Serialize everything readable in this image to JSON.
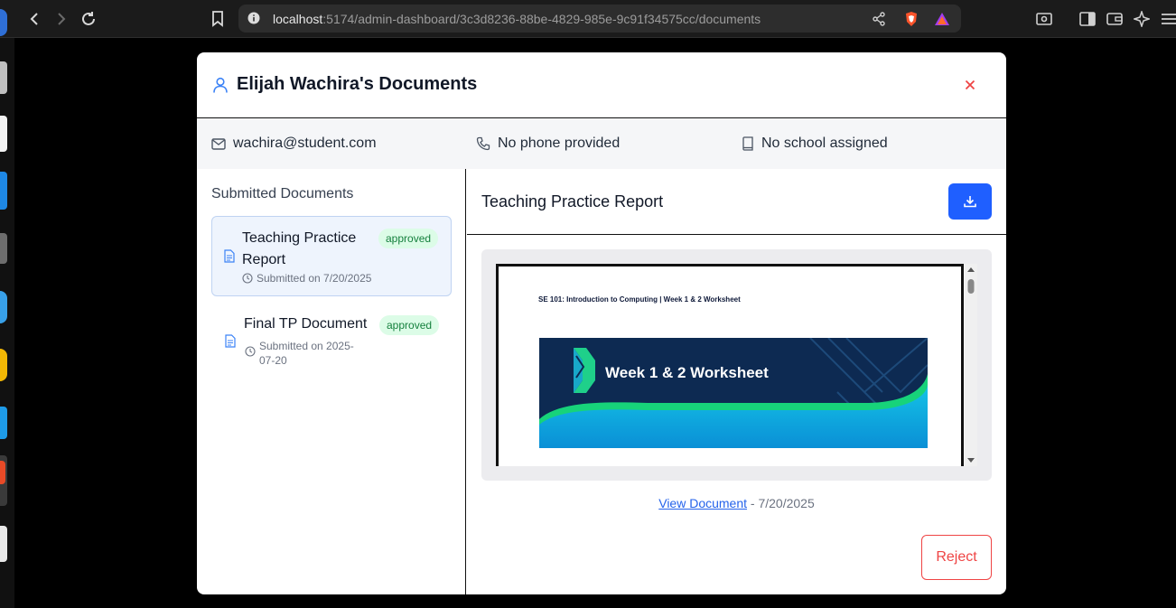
{
  "browser": {
    "url_host": "localhost",
    "url_rest": ":5174/admin-dashboard/3c3d8236-88be-4829-985e-9c91f34575cc/documents"
  },
  "modal": {
    "title": "Elijah Wachira's Documents",
    "close_label": "×"
  },
  "student": {
    "email": "wachira@student.com",
    "phone": "No phone provided",
    "school": "No school assigned"
  },
  "documents": {
    "section_title": "Submitted Documents",
    "items": [
      {
        "name": "Teaching Practice Report",
        "status": "approved",
        "submitted": "Submitted on 7/20/2025"
      },
      {
        "name": "Final TP Document",
        "status": "approved",
        "submitted": "Submitted on 2025-07-20"
      }
    ]
  },
  "preview": {
    "title": "Teaching Practice Report",
    "course_line": "SE 101: Introduction to Computing | Week 1 & 2 Worksheet",
    "banner_title": "Week 1 & 2 Worksheet",
    "view_link": "View Document",
    "date_suffix": " - 7/20/2025",
    "reject_label": "Reject"
  },
  "colors": {
    "primary": "#1f5fff",
    "danger": "#ef4444",
    "approved_bg": "#dcfce7",
    "approved_text": "#15803d",
    "active_card_bg": "#eef4fd"
  }
}
